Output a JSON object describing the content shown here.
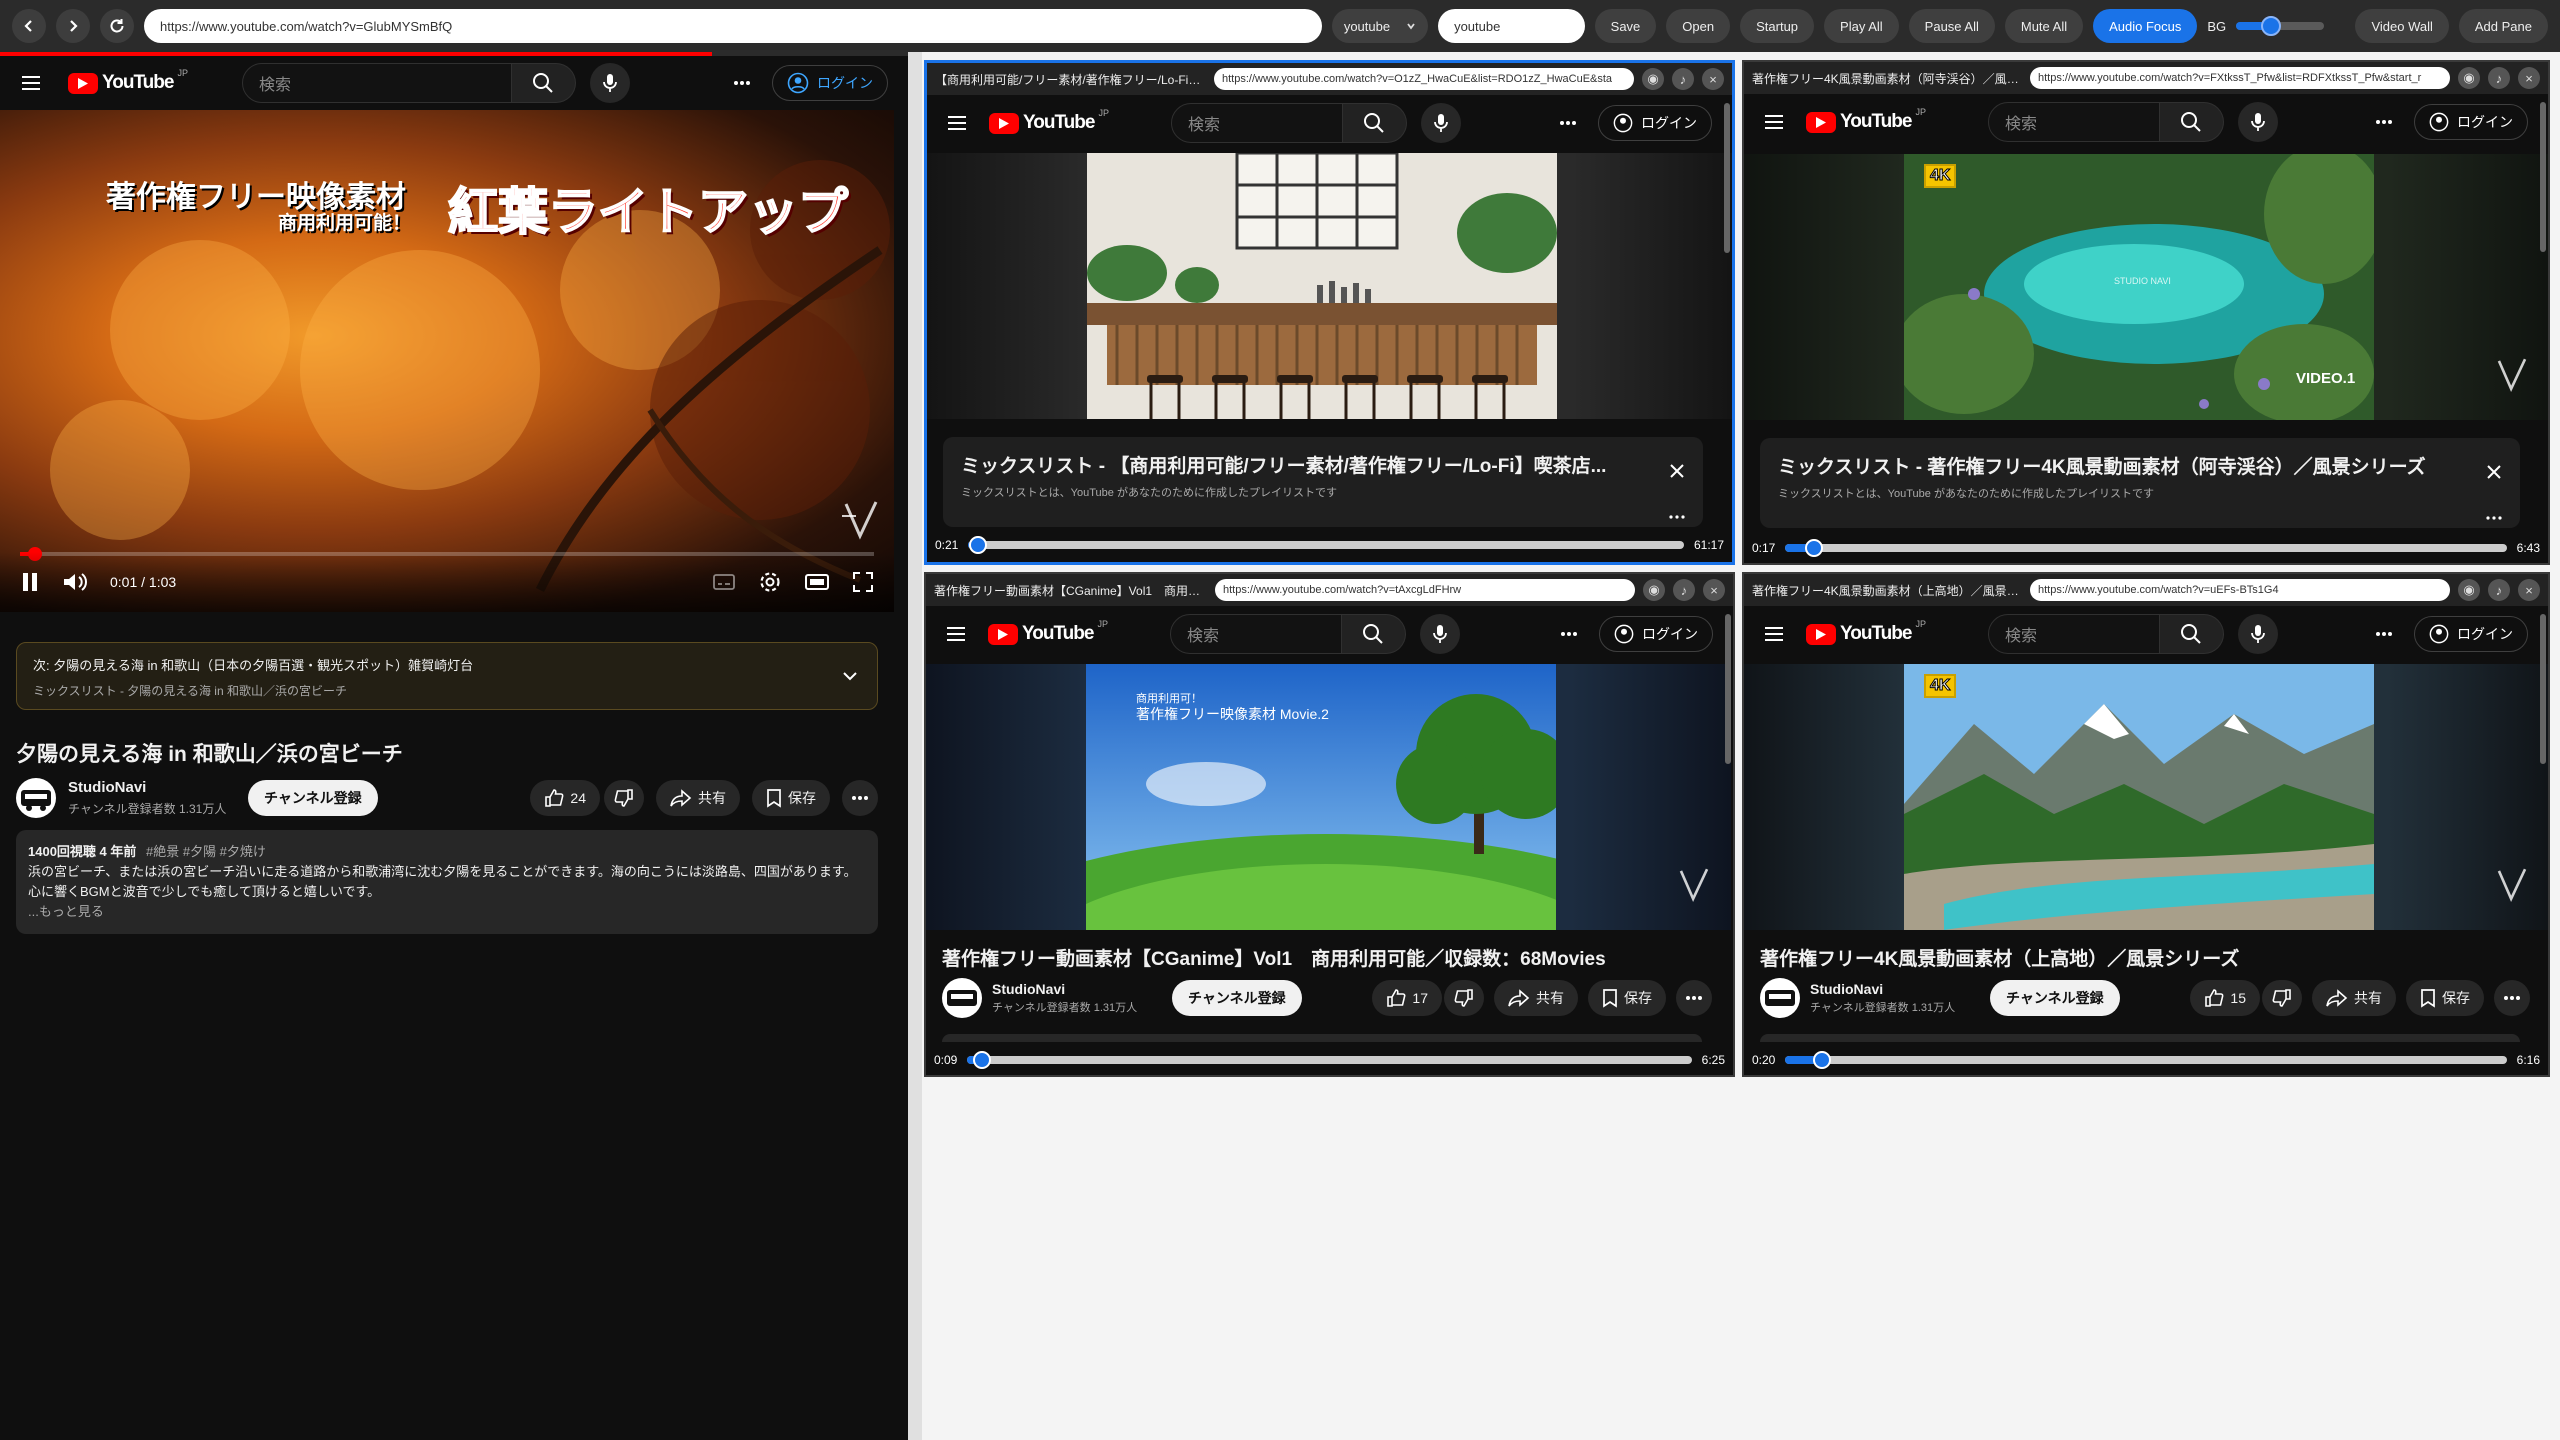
{
  "toolbar": {
    "url": "https://www.youtube.com/watch?v=GlubMYSmBfQ",
    "select_value": "youtube",
    "search_value": "youtube",
    "buttons": [
      "Save",
      "Open",
      "Startup",
      "Play All",
      "Pause All",
      "Mute All",
      "Audio Focus"
    ],
    "bg_label": "BG",
    "bg_level": 0.4,
    "right_buttons": [
      "Video Wall",
      "Add Pane"
    ]
  },
  "yt": {
    "logo": "YouTube",
    "logo_region": "JP",
    "search_placeholder": "検索",
    "login": "ログイン"
  },
  "main": {
    "overlay_title": "著作権フリー映像素材",
    "overlay_sub": "商用利用可能！",
    "overlay_big": "紅葉ライトアップ",
    "time": "0:01 / 1:03",
    "progress": 0.016,
    "next_label": "次: 夕陽の見える海 in 和歌山（日本の夕陽百選・観光スポット）雑賀崎灯台",
    "next_sub": "ミックスリスト - 夕陽の見える海 in 和歌山／浜の宮ビーチ",
    "title": "夕陽の見える海 in 和歌山／浜の宮ビーチ",
    "channel": "StudioNavi",
    "subs": "チャンネル登録者数 1.31万人",
    "subscribe": "チャンネル登録",
    "likes": "24",
    "share": "共有",
    "save": "保存",
    "desc_stats": "1400回視聴  4 年前",
    "desc_tags": "#絶景 #夕陽 #夕焼け",
    "desc_text": "浜の宮ビーチ、または浜の宮ビーチ沿いに走る道路から和歌浦湾に沈む夕陽を見ることができます。海の向こうには淡路島、四国があります。心に響くBGMと波音で少しでも癒して頂けると嬉しいです。",
    "desc_more": "...もっと見る"
  },
  "panes": [
    {
      "title": "【商用利用可能/フリー素材/著作権フリー/Lo-Fi】...",
      "url": "https://www.youtube.com/watch?v=O1zZ_HwaCuE&list=RDO1zZ_HwaCuE&sta",
      "card_title": "ミックスリスト - 【商用利用可能/フリー素材/著作権フリー/Lo-Fi】喫茶店...",
      "card_sub": "ミックスリストとは、YouTube があなたのために作成したプレイリストです",
      "time_left": "0:21",
      "time_right": "61:17",
      "progress": 0.006
    },
    {
      "title": "著作権フリー4K風景動画素材（阿寺渓谷）／風景...",
      "url": "https://www.youtube.com/watch?v=FXtkssT_Pfw&list=RDFXtkssT_Pfw&start_r",
      "card_title": "ミックスリスト - 著作権フリー4K風景動画素材（阿寺渓谷）／風景シリーズ",
      "card_sub": "ミックスリストとは、YouTube があなたのために作成したプレイリストです",
      "time_left": "0:17",
      "time_right": "6:43",
      "progress": 0.042,
      "badge": "4K",
      "watermark": "STUDIO NAVI",
      "video_tag": "VIDEO.1"
    },
    {
      "title": "著作権フリー動画素材【CGanime】Vol1　商用利...",
      "url": "https://www.youtube.com/watch?v=tAxcgLdFHrw",
      "video_title": "著作権フリー動画素材【CGanime】Vol1　商用利用可能／収録数：68Movies",
      "overlay_sub": "商用利用可！",
      "overlay_title": "著作権フリー映像素材  Movie.2",
      "channel": "StudioNavi",
      "subs": "チャンネル登録者数 1.31万人",
      "subscribe": "チャンネル登録",
      "likes": "17",
      "share": "共有",
      "save": "保存",
      "time_left": "0:09",
      "time_right": "6:25",
      "progress": 0.023
    },
    {
      "title": "著作権フリー4K風景動画素材（上高地）／風景シ...",
      "url": "https://www.youtube.com/watch?v=uEFs-BTs1G4",
      "video_title": "著作権フリー4K風景動画素材（上高地）／風景シリーズ",
      "channel": "StudioNavi",
      "subs": "チャンネル登録者数 1.31万人",
      "subscribe": "チャンネル登録",
      "likes": "15",
      "share": "共有",
      "save": "保存",
      "time_left": "0:20",
      "time_right": "6:16",
      "progress": 0.053,
      "badge": "4K"
    }
  ]
}
